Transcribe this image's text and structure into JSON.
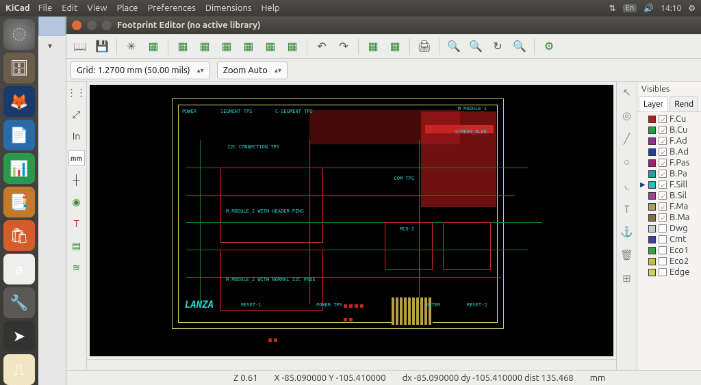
{
  "menubar": {
    "app": "KiCad",
    "items": [
      "File",
      "Edit",
      "View",
      "Place",
      "Preferences",
      "Dimensions",
      "Help"
    ],
    "lang": "En",
    "time": "14:10"
  },
  "window": {
    "title": "Footprint Editor (no active library)"
  },
  "toolbar2": {
    "grid": "Grid: 1.2700 mm (50.00 mils)",
    "zoom": "Zoom Auto"
  },
  "left_tools": {
    "mm": "mm"
  },
  "layers": {
    "header": "Visibles",
    "tab_layer": "Layer",
    "tab_render": "Rend",
    "items": [
      {
        "color": "#b02020",
        "checked": true,
        "name": "F.Cu"
      },
      {
        "color": "#20a040",
        "checked": true,
        "name": "B.Cu"
      },
      {
        "color": "#903090",
        "checked": true,
        "name": "F.Ad"
      },
      {
        "color": "#2040a0",
        "checked": true,
        "name": "B.Ad"
      },
      {
        "color": "#a02080",
        "checked": true,
        "name": "F.Pas"
      },
      {
        "color": "#20a0a0",
        "checked": true,
        "name": "B.Pa"
      },
      {
        "color": "#20c0c0",
        "checked": true,
        "name": "F.Sill",
        "active": true
      },
      {
        "color": "#a040a0",
        "checked": true,
        "name": "B.Sil"
      },
      {
        "color": "#a0a060",
        "checked": true,
        "name": "F.Ma"
      },
      {
        "color": "#807040",
        "checked": true,
        "name": "B.Ma"
      },
      {
        "color": "#cccccc",
        "checked": false,
        "name": "Dwg"
      },
      {
        "color": "#4040a0",
        "checked": false,
        "name": "Cmt"
      },
      {
        "color": "#40a040",
        "checked": false,
        "name": "Eco1"
      },
      {
        "color": "#c0c040",
        "checked": false,
        "name": "Eco2"
      },
      {
        "color": "#d0d060",
        "checked": false,
        "name": "Edge"
      }
    ]
  },
  "status": {
    "z": "Z 0.61",
    "xy": "X -85.090000  Y -105.410000",
    "dxy": "dx -85.090000  dy -105.410000  dist 135.468",
    "unit": "mm"
  },
  "canvas_text": {
    "power": "POWER",
    "segment": "SEGMENT TPS",
    "csegment": "C-SEGMENT TPS",
    "i2c": "I2C CONNECTION TPS",
    "module2": "M_MODULE_2 WITH HEADER PINS",
    "module2b": "M_MODULE_2 WITH NORMAL I2C PADS",
    "reset": "RESET-1",
    "powertps": "POWER TPS",
    "enter": "ENTER",
    "reset2": "RESET-2",
    "mmodule1": "M_MODULE_1",
    "screen": "SCREEN_OLED",
    "comtps": "COM TPS",
    "mcu": "MCU-2",
    "logo": "LANZA"
  }
}
